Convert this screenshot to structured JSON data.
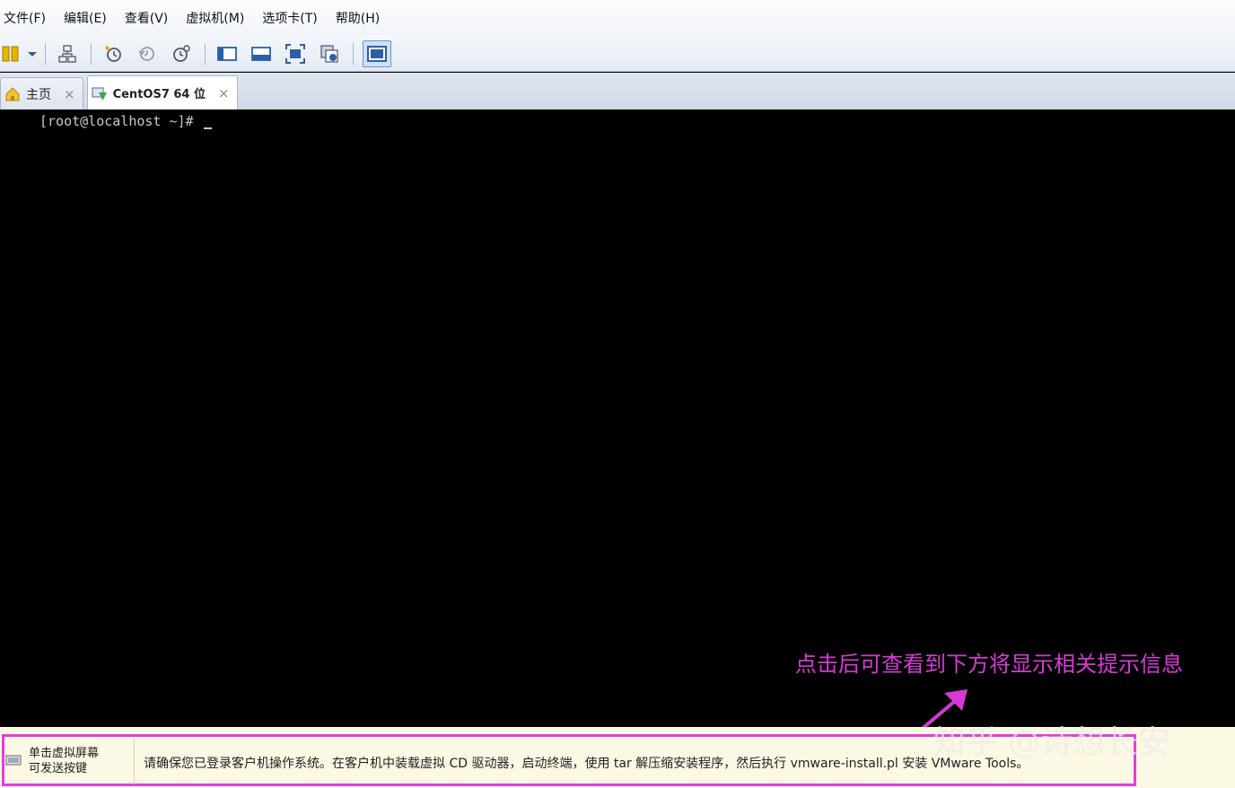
{
  "menubar": {
    "items": [
      "文件(F)",
      "编辑(E)",
      "查看(V)",
      "虚拟机(M)",
      "选项卡(T)",
      "帮助(H)"
    ]
  },
  "toolbar": {
    "icons": [
      "pause-icon",
      "dropdown-icon",
      "network-icon",
      "snapshot-take-icon",
      "snapshot-revert-icon",
      "snapshot-manager-icon",
      "console-view-icon",
      "thumbnail-view-icon",
      "fullscreen-icon",
      "unity-icon",
      "single-window-icon"
    ]
  },
  "tabs": [
    {
      "label": "主页",
      "icon": "home-icon",
      "close": "×"
    },
    {
      "label": "CentOS7 64 位",
      "icon": "vm-icon",
      "close": "×"
    }
  ],
  "console": {
    "prompt": "[root@localhost ~]#"
  },
  "annotation": {
    "text": "点击后可查看到下方将显示相关提示信息"
  },
  "hintbar": {
    "left_line1": "单击虚拟屏幕",
    "left_line2": "可发送按键",
    "message": "请确保您已登录客户机操作系统。在客户机中装载虚拟 CD 驱动器，启动终端，使用 tar 解压缩安装程序，然后执行 vmware-install.pl 安装 VMware Tools。"
  },
  "watermark": "知乎 @诗想长安",
  "colors": {
    "annotation": "#d63ad6",
    "frame": "#e23ee2",
    "console_bg": "#000000",
    "hint_bg": "#fbf8e3"
  }
}
